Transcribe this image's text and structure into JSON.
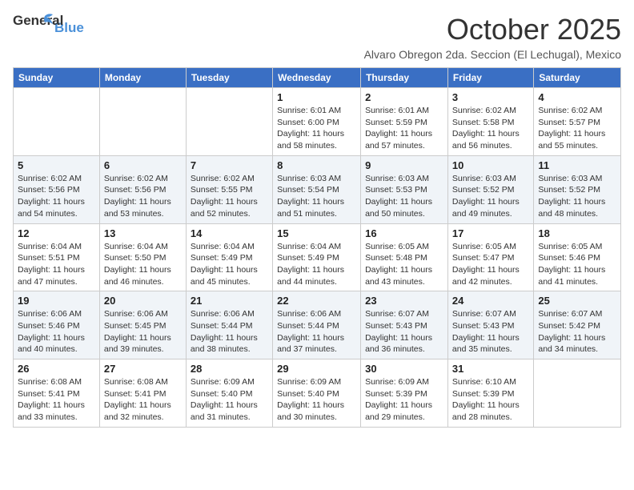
{
  "logo": {
    "general": "General",
    "blue": "Blue"
  },
  "header": {
    "month": "October 2025",
    "location": "Alvaro Obregon 2da. Seccion (El Lechugal), Mexico"
  },
  "weekdays": [
    "Sunday",
    "Monday",
    "Tuesday",
    "Wednesday",
    "Thursday",
    "Friday",
    "Saturday"
  ],
  "weeks": [
    [
      {
        "day": "",
        "info": ""
      },
      {
        "day": "",
        "info": ""
      },
      {
        "day": "",
        "info": ""
      },
      {
        "day": "1",
        "info": "Sunrise: 6:01 AM\nSunset: 6:00 PM\nDaylight: 11 hours and 58 minutes."
      },
      {
        "day": "2",
        "info": "Sunrise: 6:01 AM\nSunset: 5:59 PM\nDaylight: 11 hours and 57 minutes."
      },
      {
        "day": "3",
        "info": "Sunrise: 6:02 AM\nSunset: 5:58 PM\nDaylight: 11 hours and 56 minutes."
      },
      {
        "day": "4",
        "info": "Sunrise: 6:02 AM\nSunset: 5:57 PM\nDaylight: 11 hours and 55 minutes."
      }
    ],
    [
      {
        "day": "5",
        "info": "Sunrise: 6:02 AM\nSunset: 5:56 PM\nDaylight: 11 hours and 54 minutes."
      },
      {
        "day": "6",
        "info": "Sunrise: 6:02 AM\nSunset: 5:56 PM\nDaylight: 11 hours and 53 minutes."
      },
      {
        "day": "7",
        "info": "Sunrise: 6:02 AM\nSunset: 5:55 PM\nDaylight: 11 hours and 52 minutes."
      },
      {
        "day": "8",
        "info": "Sunrise: 6:03 AM\nSunset: 5:54 PM\nDaylight: 11 hours and 51 minutes."
      },
      {
        "day": "9",
        "info": "Sunrise: 6:03 AM\nSunset: 5:53 PM\nDaylight: 11 hours and 50 minutes."
      },
      {
        "day": "10",
        "info": "Sunrise: 6:03 AM\nSunset: 5:52 PM\nDaylight: 11 hours and 49 minutes."
      },
      {
        "day": "11",
        "info": "Sunrise: 6:03 AM\nSunset: 5:52 PM\nDaylight: 11 hours and 48 minutes."
      }
    ],
    [
      {
        "day": "12",
        "info": "Sunrise: 6:04 AM\nSunset: 5:51 PM\nDaylight: 11 hours and 47 minutes."
      },
      {
        "day": "13",
        "info": "Sunrise: 6:04 AM\nSunset: 5:50 PM\nDaylight: 11 hours and 46 minutes."
      },
      {
        "day": "14",
        "info": "Sunrise: 6:04 AM\nSunset: 5:49 PM\nDaylight: 11 hours and 45 minutes."
      },
      {
        "day": "15",
        "info": "Sunrise: 6:04 AM\nSunset: 5:49 PM\nDaylight: 11 hours and 44 minutes."
      },
      {
        "day": "16",
        "info": "Sunrise: 6:05 AM\nSunset: 5:48 PM\nDaylight: 11 hours and 43 minutes."
      },
      {
        "day": "17",
        "info": "Sunrise: 6:05 AM\nSunset: 5:47 PM\nDaylight: 11 hours and 42 minutes."
      },
      {
        "day": "18",
        "info": "Sunrise: 6:05 AM\nSunset: 5:46 PM\nDaylight: 11 hours and 41 minutes."
      }
    ],
    [
      {
        "day": "19",
        "info": "Sunrise: 6:06 AM\nSunset: 5:46 PM\nDaylight: 11 hours and 40 minutes."
      },
      {
        "day": "20",
        "info": "Sunrise: 6:06 AM\nSunset: 5:45 PM\nDaylight: 11 hours and 39 minutes."
      },
      {
        "day": "21",
        "info": "Sunrise: 6:06 AM\nSunset: 5:44 PM\nDaylight: 11 hours and 38 minutes."
      },
      {
        "day": "22",
        "info": "Sunrise: 6:06 AM\nSunset: 5:44 PM\nDaylight: 11 hours and 37 minutes."
      },
      {
        "day": "23",
        "info": "Sunrise: 6:07 AM\nSunset: 5:43 PM\nDaylight: 11 hours and 36 minutes."
      },
      {
        "day": "24",
        "info": "Sunrise: 6:07 AM\nSunset: 5:43 PM\nDaylight: 11 hours and 35 minutes."
      },
      {
        "day": "25",
        "info": "Sunrise: 6:07 AM\nSunset: 5:42 PM\nDaylight: 11 hours and 34 minutes."
      }
    ],
    [
      {
        "day": "26",
        "info": "Sunrise: 6:08 AM\nSunset: 5:41 PM\nDaylight: 11 hours and 33 minutes."
      },
      {
        "day": "27",
        "info": "Sunrise: 6:08 AM\nSunset: 5:41 PM\nDaylight: 11 hours and 32 minutes."
      },
      {
        "day": "28",
        "info": "Sunrise: 6:09 AM\nSunset: 5:40 PM\nDaylight: 11 hours and 31 minutes."
      },
      {
        "day": "29",
        "info": "Sunrise: 6:09 AM\nSunset: 5:40 PM\nDaylight: 11 hours and 30 minutes."
      },
      {
        "day": "30",
        "info": "Sunrise: 6:09 AM\nSunset: 5:39 PM\nDaylight: 11 hours and 29 minutes."
      },
      {
        "day": "31",
        "info": "Sunrise: 6:10 AM\nSunset: 5:39 PM\nDaylight: 11 hours and 28 minutes."
      },
      {
        "day": "",
        "info": ""
      }
    ]
  ]
}
